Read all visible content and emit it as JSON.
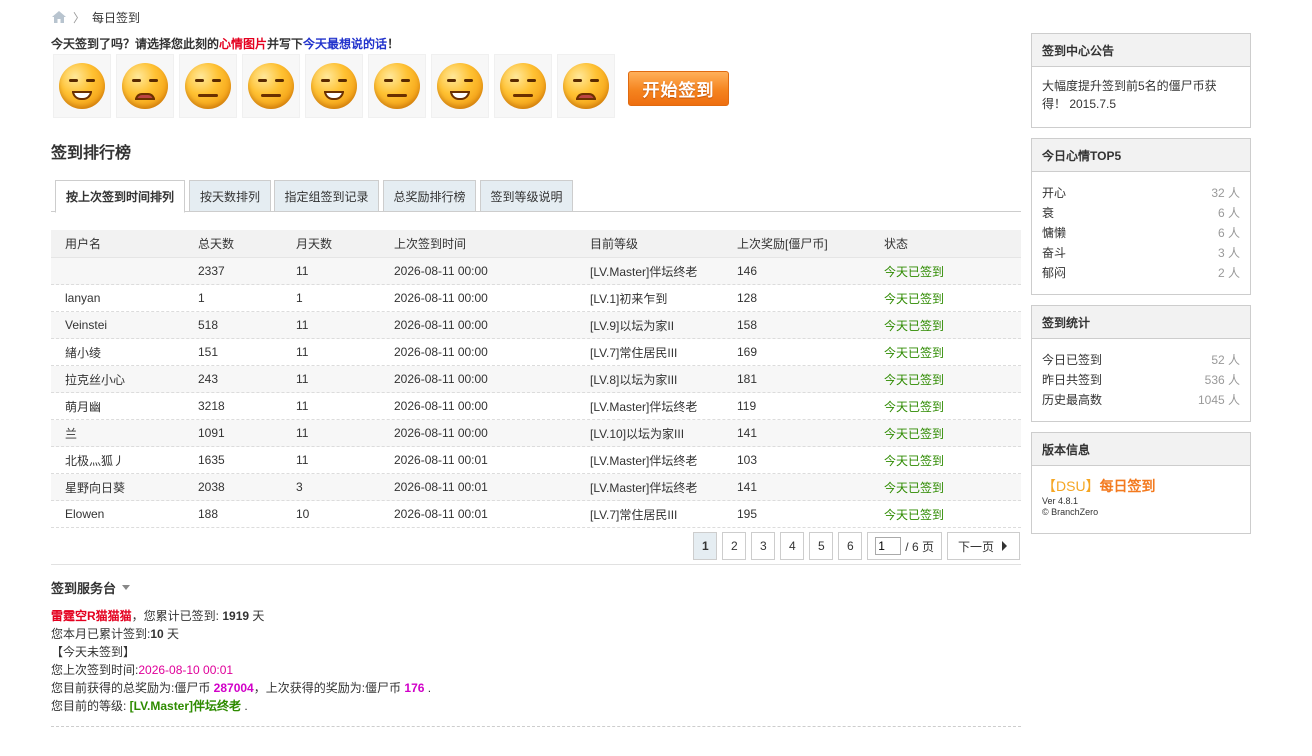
{
  "breadcrumb": {
    "current": "每日签到"
  },
  "prompt": {
    "part1": "今天签到了吗？请选择您此刻的",
    "highlight1": "心情图片",
    "part2": "并写下",
    "highlight2": "今天最想说的话",
    "part3": "！"
  },
  "emoticons": [
    "kaixin",
    "nangguo",
    "yumen",
    "wuliao",
    "fennu",
    "ca-han",
    "fendou",
    "yongmei",
    "daku"
  ],
  "start_button": "开始签到",
  "ranking_title": "签到排行榜",
  "tabs": [
    "按上次签到时间排列",
    "按天数排列",
    "指定组签到记录",
    "总奖励排行榜",
    "签到等级说明"
  ],
  "table": {
    "headers": [
      "用户名",
      "总天数",
      "月天数",
      "上次签到时间",
      "目前等级",
      "上次奖励[僵尸币]",
      "状态"
    ],
    "rows": [
      [
        "",
        "2337",
        "11",
        "2026-08-11 00:00",
        "[LV.Master]伴坛终老",
        "146",
        "今天已签到"
      ],
      [
        "lanyan",
        "1",
        "1",
        "2026-08-11 00:00",
        "[LV.1]初来乍到",
        "128",
        "今天已签到"
      ],
      [
        "Veinstei",
        "518",
        "11",
        "2026-08-11 00:00",
        "[LV.9]以坛为家II",
        "158",
        "今天已签到"
      ],
      [
        "緖小绫",
        "151",
        "11",
        "2026-08-11 00:00",
        "[LV.7]常住居民III",
        "169",
        "今天已签到"
      ],
      [
        "拉克丝小心",
        "243",
        "11",
        "2026-08-11 00:00",
        "[LV.8]以坛为家III",
        "181",
        "今天已签到"
      ],
      [
        "萌月幽",
        "3218",
        "11",
        "2026-08-11 00:00",
        "[LV.Master]伴坛终老",
        "119",
        "今天已签到"
      ],
      [
        "兰",
        "1091",
        "11",
        "2026-08-11 00:00",
        "[LV.10]以坛为家III",
        "141",
        "今天已签到"
      ],
      [
        "北极灬狐丿",
        "1635",
        "11",
        "2026-08-11 00:01",
        "[LV.Master]伴坛终老",
        "103",
        "今天已签到"
      ],
      [
        "星野向日葵",
        "2038",
        "3",
        "2026-08-11 00:01",
        "[LV.Master]伴坛终老",
        "141",
        "今天已签到"
      ],
      [
        "Elowen",
        "188",
        "10",
        "2026-08-11 00:01",
        "[LV.7]常住居民III",
        "195",
        "今天已签到"
      ]
    ]
  },
  "pager": {
    "pages": [
      "1",
      "2",
      "3",
      "4",
      "5",
      "6"
    ],
    "current": "1",
    "input_value": "1",
    "total": "/ 6 页",
    "next": "下一页"
  },
  "service": {
    "title": "签到服务台",
    "username": "雷霆空R猫猫猫",
    "l1_a": "，您累计已签到: ",
    "total_days": "1919",
    "l1_b": " 天",
    "l2_a": "您本月已累计签到:",
    "month_days": "10",
    "l2_b": " 天",
    "l3": "【今天未签到】",
    "l4_a": "您上次签到时间:",
    "last_time": "2026-08-10 00:01",
    "l5_a": "您目前获得的总奖励为:僵尸币 ",
    "total_reward": "287004",
    "l5_b": "，上次获得的奖励为:僵尸币 ",
    "last_reward": "176",
    "l5_c": " .",
    "l6_a": "您目前的等级: ",
    "level": "[LV.Master]伴坛终老",
    "l6_b": " ."
  },
  "sidebar": {
    "notice": {
      "title": "签到中心公告",
      "text": "大幅度提升签到前5名的僵尸币获得！ 2015.7.5"
    },
    "mood": {
      "title": "今日心情TOP5",
      "items": [
        {
          "label": "开心",
          "value": "32 人"
        },
        {
          "label": "衰",
          "value": "6 人"
        },
        {
          "label": "慵懒",
          "value": "6 人"
        },
        {
          "label": "奋斗",
          "value": "3 人"
        },
        {
          "label": "郁闷",
          "value": "2 人"
        }
      ]
    },
    "stats": {
      "title": "签到统计",
      "items": [
        {
          "label": "今日已签到",
          "value": "52 人"
        },
        {
          "label": "昨日共签到",
          "value": "536 人"
        },
        {
          "label": "历史最高数",
          "value": "1045 人"
        }
      ]
    },
    "version": {
      "title": "版本信息",
      "brand_bracket": "【DSU】",
      "brand_name": "每日签到",
      "ver": "Ver 4.8.1",
      "copyright": "© BranchZero"
    }
  }
}
